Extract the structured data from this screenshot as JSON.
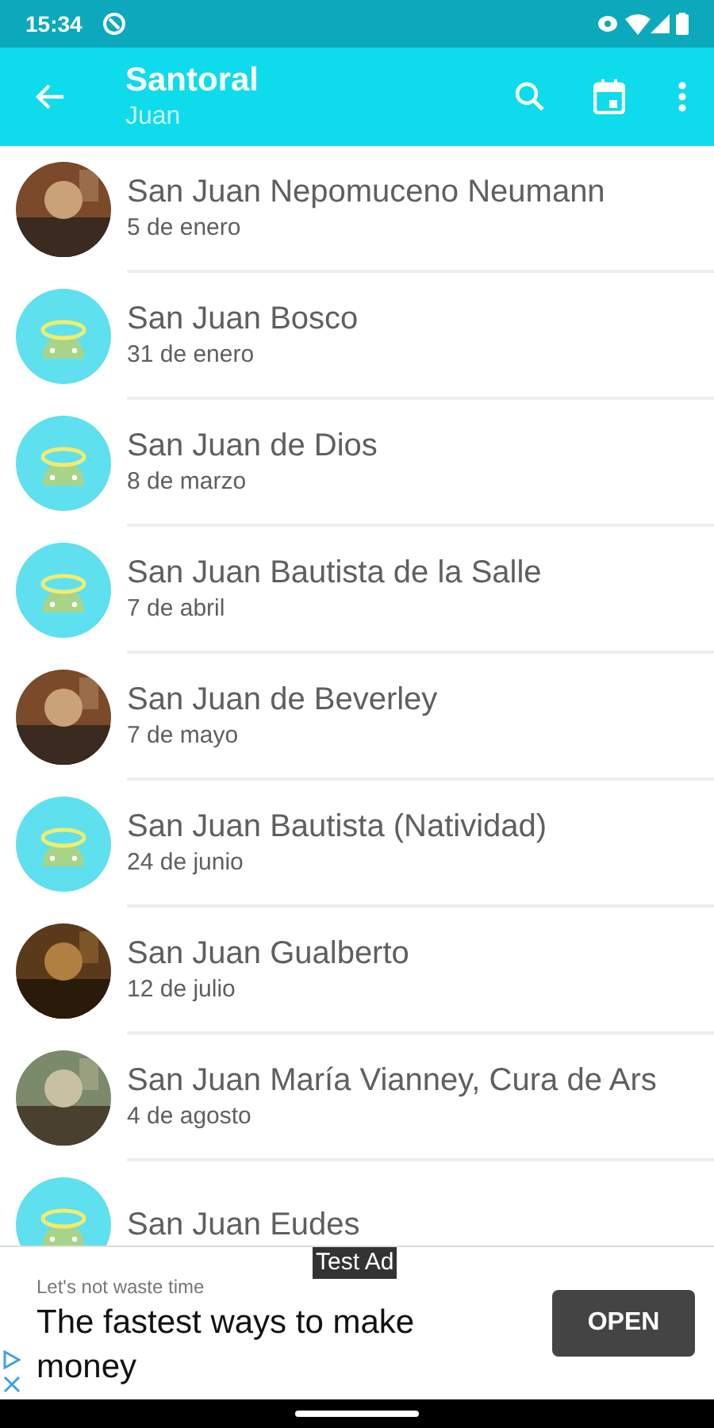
{
  "status_bar": {
    "time": "15:34"
  },
  "app_bar": {
    "title": "Santoral",
    "subtitle": "Juan"
  },
  "saints": [
    {
      "name": "San Juan Nepomuceno Neumann",
      "date": "5 de enero",
      "kind": "picture"
    },
    {
      "name": "San Juan Bosco",
      "date": "31 de enero",
      "kind": "default"
    },
    {
      "name": "San Juan de Dios",
      "date": "8 de marzo",
      "kind": "default"
    },
    {
      "name": "San Juan Bautista de la Salle",
      "date": "7 de abril",
      "kind": "default"
    },
    {
      "name": "San Juan de Beverley",
      "date": "7 de mayo",
      "kind": "picture"
    },
    {
      "name": "San Juan Bautista (Natividad)",
      "date": "24 de junio",
      "kind": "default"
    },
    {
      "name": "San Juan Gualberto",
      "date": "12 de julio",
      "kind": "picture"
    },
    {
      "name": "San Juan María Vianney, Cura de Ars",
      "date": "4 de agosto",
      "kind": "picture"
    },
    {
      "name": "San Juan Eudes",
      "kind": "default"
    }
  ],
  "ad": {
    "label": "Test Ad",
    "tagline": "Let's not waste time",
    "headline": "The fastest ways to make money",
    "button": "OPEN"
  }
}
